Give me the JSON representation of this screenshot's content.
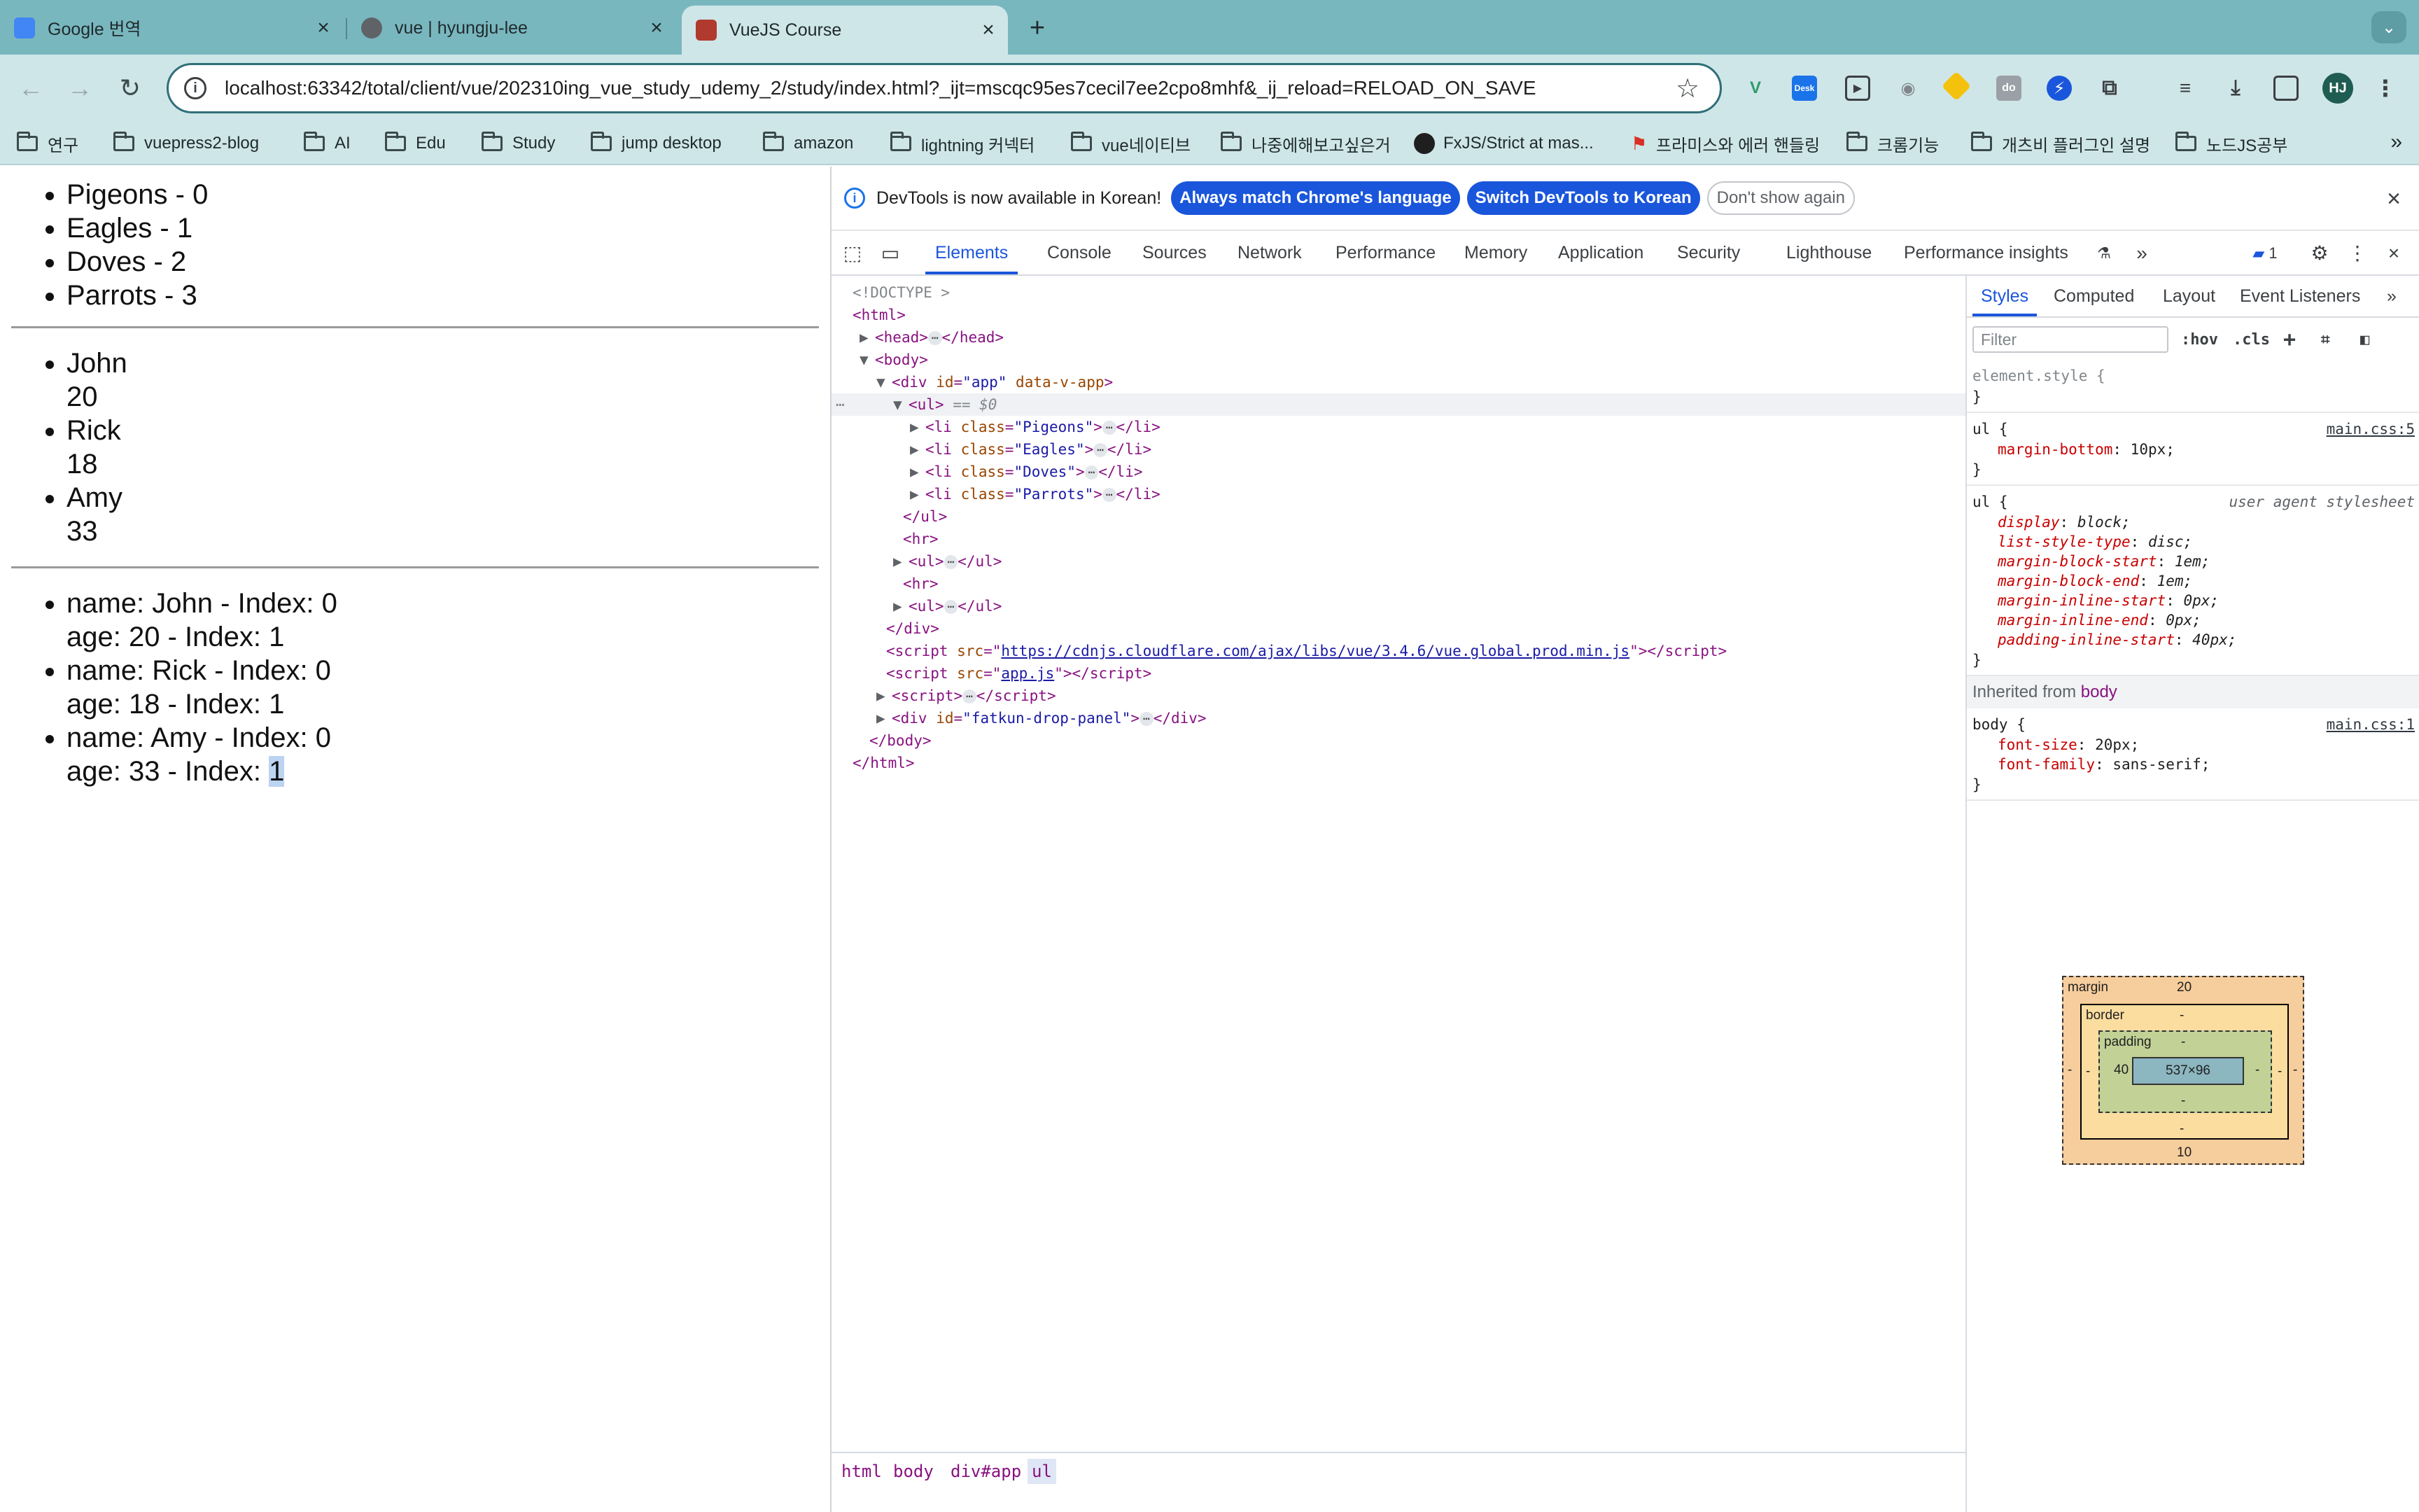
{
  "tabs": [
    {
      "title": "Google 번역",
      "favicon_color": "#4285f4"
    },
    {
      "title": "vue | hyungju-lee",
      "favicon_color": "#5f6368"
    },
    {
      "title": "VueJS Course",
      "favicon_color": "#b03a2e"
    }
  ],
  "toolbar": {
    "url": "localhost:63342/total/client/vue/202310ing_vue_study_udemy_2/study/index.html?_ijt=mscqc95es7cecil7ee2cpo8mhf&_ij_reload=RELOAD_ON_SAVE",
    "profile_initials": "HJ"
  },
  "bookmarks": [
    {
      "label": "연구",
      "icon": "folder-icon"
    },
    {
      "label": "vuepress2-blog",
      "icon": "folder-icon"
    },
    {
      "label": "AI",
      "icon": "folder-icon"
    },
    {
      "label": "Edu",
      "icon": "folder-icon"
    },
    {
      "label": "Study",
      "icon": "folder-icon"
    },
    {
      "label": "jump desktop",
      "icon": "folder-icon"
    },
    {
      "label": "amazon",
      "icon": "folder-icon"
    },
    {
      "label": "lightning 커넥터",
      "icon": "folder-icon"
    },
    {
      "label": "vue네이티브",
      "icon": "folder-icon"
    },
    {
      "label": "나중에해보고싶은거",
      "icon": "folder-icon"
    },
    {
      "label": "FxJS/Strict at mas...",
      "icon": "github-icon"
    },
    {
      "label": "프라미스와 에러 핸들링",
      "icon": "signpost-icon"
    },
    {
      "label": "크롬기능",
      "icon": "folder-icon"
    },
    {
      "label": "개츠비 플러그인 설명",
      "icon": "folder-icon"
    },
    {
      "label": "노드JS공부",
      "icon": "folder-icon"
    }
  ],
  "page": {
    "birds": [
      "Pigeons - 0",
      "Eagles - 1",
      "Doves - 2",
      "Parrots - 3"
    ],
    "people": [
      {
        "name": "John",
        "age": "20"
      },
      {
        "name": "Rick",
        "age": "18"
      },
      {
        "name": "Amy",
        "age": "33"
      }
    ],
    "people_indexed": [
      {
        "name_line": "name: John - Index: 0",
        "age_line": "age: 20 - Index: 1"
      },
      {
        "name_line": "name: Rick - Index: 0",
        "age_line": "age: 18 - Index: 1"
      },
      {
        "name_line": "name: Amy - Index: 0",
        "age_line_prefix": "age: 33 - Index: ",
        "age_line_selected": "1"
      }
    ]
  },
  "devtools": {
    "infobar": {
      "message": "DevTools is now available in Korean!",
      "btn_match": "Always match Chrome's language",
      "btn_switch": "Switch DevTools to Korean",
      "btn_dismiss": "Don't show again"
    },
    "tabs": [
      "Elements",
      "Console",
      "Sources",
      "Network",
      "Performance",
      "Memory",
      "Application",
      "Security",
      "Lighthouse",
      "Performance insights"
    ],
    "issues_count": "1",
    "tree": {
      "doctype": "<!DOCTYPE >",
      "html_open": "<html>",
      "head": "head",
      "body_open": "<body>",
      "app_id": "\"app\"",
      "app_extra": "data-v-app",
      "selected_marker": "== $0",
      "li_classes": [
        "\"Pigeons\"",
        "\"Eagles\"",
        "\"Doves\"",
        "\"Parrots\""
      ],
      "script_cdn": "https://cdnjs.cloudflare.com/ajax/libs/vue/3.4.6/vue.global.prod.min.js",
      "script_app": "app.js",
      "fatkun_id": "\"fatkun-drop-panel\""
    },
    "breadcrumbs": [
      "html",
      "body",
      "div#app",
      "ul"
    ],
    "styles": {
      "tabs": [
        "Styles",
        "Computed",
        "Layout",
        "Event Listeners"
      ],
      "filter_placeholder": "Filter",
      "hov": ":hov",
      "cls": ".cls",
      "element_style": "element.style {",
      "rule1": {
        "selector": "ul {",
        "source": "main.css:5",
        "props": [
          {
            "name": "margin-bottom",
            "value": "10px;"
          }
        ]
      },
      "rule2": {
        "selector": "ul {",
        "source": "user agent stylesheet",
        "props": [
          {
            "name": "display",
            "value": "block;"
          },
          {
            "name": "list-style-type",
            "value": "disc;"
          },
          {
            "name": "margin-block-start",
            "value": "1em;"
          },
          {
            "name": "margin-block-end",
            "value": "1em;"
          },
          {
            "name": "margin-inline-start",
            "value": "0px;"
          },
          {
            "name": "margin-inline-end",
            "value": "0px;"
          },
          {
            "name": "padding-inline-start",
            "value": "40px;"
          }
        ]
      },
      "inherited_label": "Inherited from",
      "inherited_tag": "body",
      "rule3": {
        "selector": "body {",
        "source": "main.css:1",
        "props": [
          {
            "name": "font-size",
            "value": "20px;"
          },
          {
            "name": "font-family",
            "value": "sans-serif;"
          }
        ]
      },
      "boxmodel": {
        "margin_label": "margin",
        "margin_top": "20",
        "margin_bottom": "10",
        "margin_left": "-",
        "margin_right": "-",
        "border_label": "border",
        "border_top": "-",
        "border_bottom": "-",
        "border_left": "-",
        "border_right": "-",
        "padding_label": "padding",
        "padding_top": "-",
        "padding_bottom": "-",
        "padding_left": "40",
        "padding_right": "-",
        "content_size": "537×96"
      }
    }
  }
}
